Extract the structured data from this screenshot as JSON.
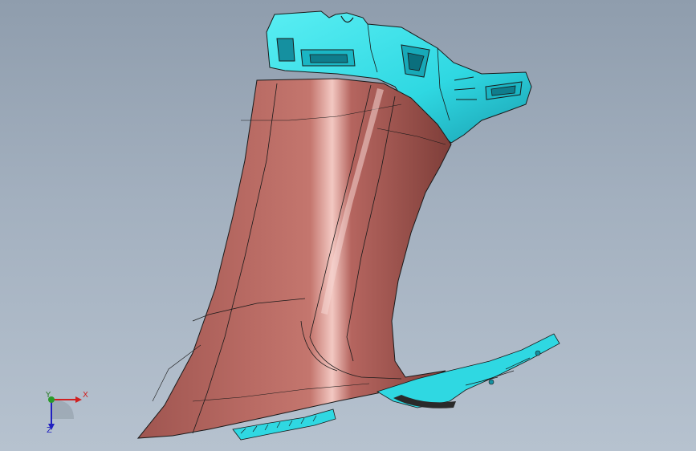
{
  "viewport": {
    "background_top": "#8f9dad",
    "background_bottom": "#b6c2cf"
  },
  "model": {
    "trim_color": "#b5655f",
    "trim_highlight": "#e2a8a2",
    "trim_shadow": "#7a3a36",
    "bracket_color": "#2fe0e8",
    "bracket_dark": "#1590a0",
    "edge_color": "#1a1a1a"
  },
  "triad": {
    "x_label": "X",
    "y_label": "Y",
    "z_label": "Z",
    "x_color": "#d02020",
    "y_color": "#2a9a2a",
    "z_color": "#2020c0"
  }
}
